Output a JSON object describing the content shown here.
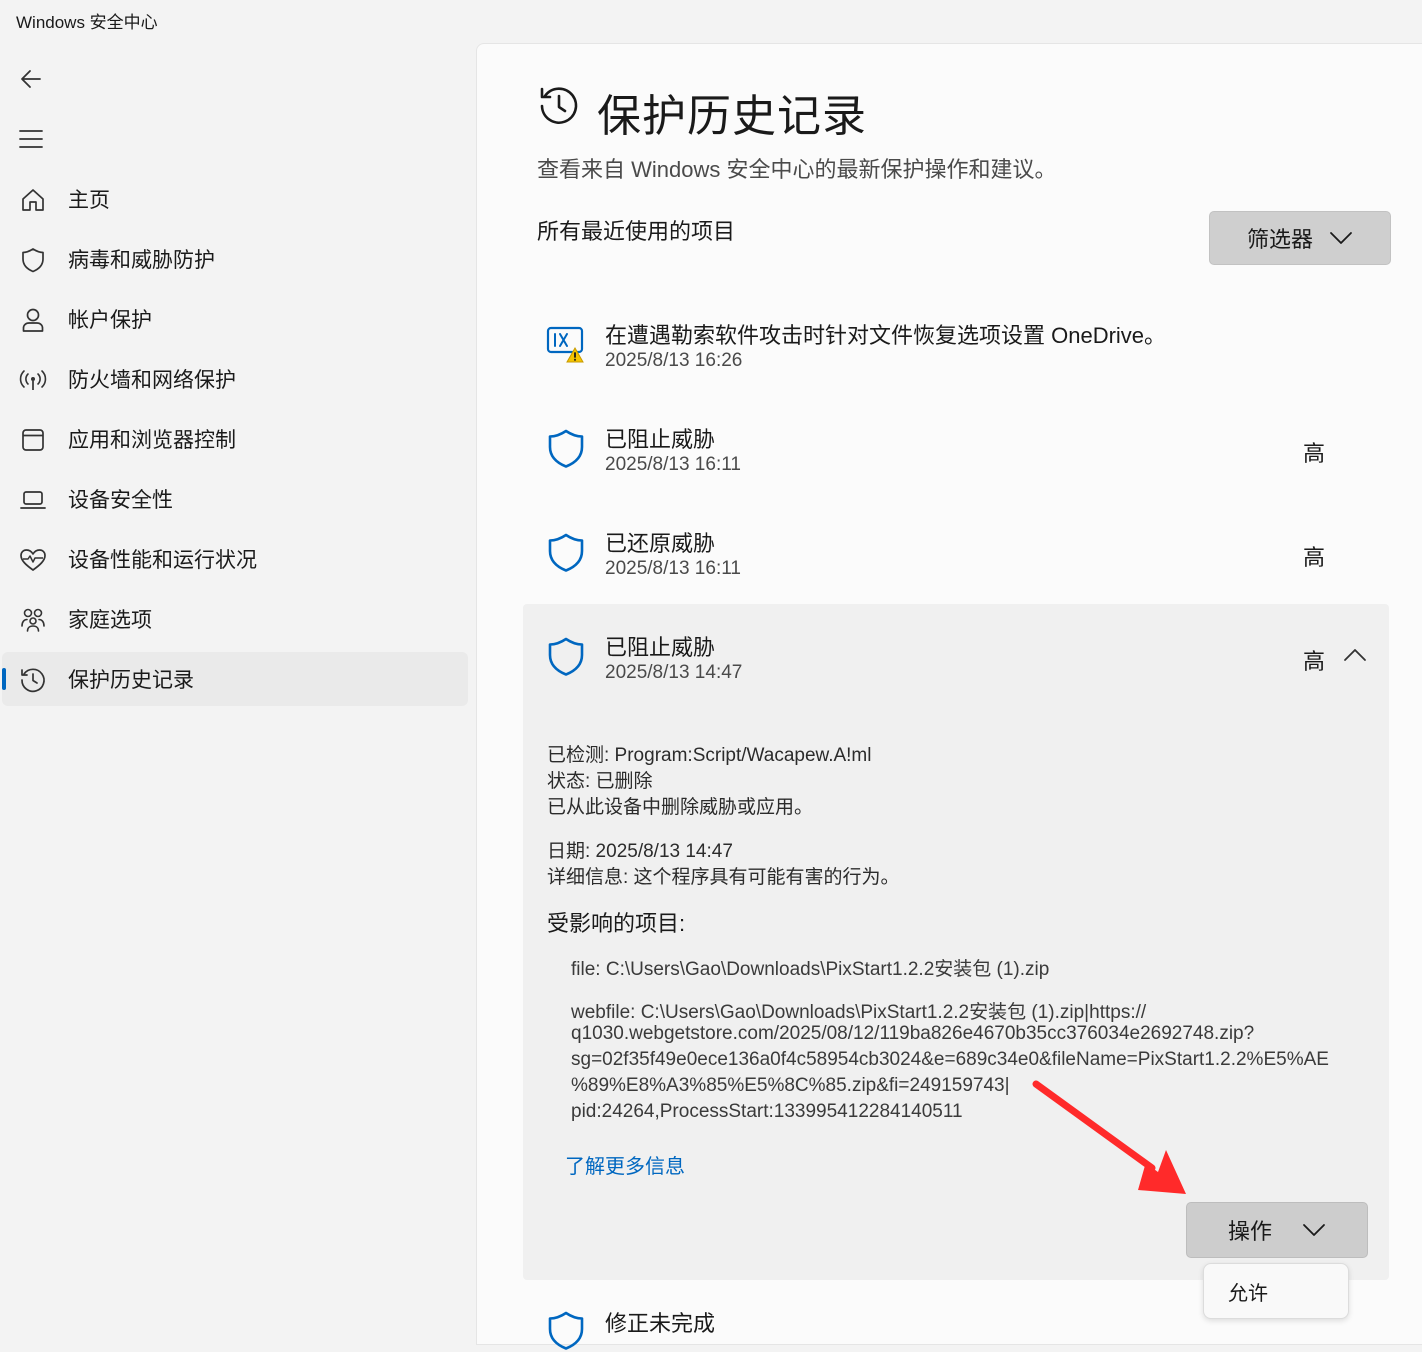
{
  "app": {
    "title": "Windows 安全中心"
  },
  "sidebar": {
    "items": [
      {
        "label": "主页",
        "icon": "home-icon"
      },
      {
        "label": "病毒和威胁防护",
        "icon": "shield-icon"
      },
      {
        "label": "帐户保护",
        "icon": "person-icon"
      },
      {
        "label": "防火墙和网络保护",
        "icon": "wifi-icon"
      },
      {
        "label": "应用和浏览器控制",
        "icon": "window-icon"
      },
      {
        "label": "设备安全性",
        "icon": "laptop-icon"
      },
      {
        "label": "设备性能和运行状况",
        "icon": "heart-icon"
      },
      {
        "label": "家庭选项",
        "icon": "family-icon"
      },
      {
        "label": "保护历史记录",
        "icon": "history-icon",
        "active": true
      }
    ]
  },
  "main": {
    "title": "保护历史记录",
    "subtitle": "查看来自 Windows 安全中心的最新保护操作和建议。",
    "section_label": "所有最近使用的项目",
    "filter_label": "筛选器",
    "entries": [
      {
        "title": "在遭遇勒索软件攻击时针对文件恢复选项设置 OneDrive。",
        "time": "2025/8/13 16:26",
        "severity": ""
      },
      {
        "title": "已阻止威胁",
        "time": "2025/8/13 16:11",
        "severity": "高"
      },
      {
        "title": "已还原威胁",
        "time": "2025/8/13 16:11",
        "severity": "高"
      },
      {
        "title": "已阻止威胁",
        "time": "2025/8/13 14:47",
        "severity": "高"
      }
    ],
    "detail": {
      "detected": "已检测:  Program:Script/Wacapew.A!ml",
      "status": "状态:  已删除",
      "status_desc": "已从此设备中删除威胁或应用。",
      "date": "日期:  2025/8/13 14:47",
      "details": "详细信息:  这个程序具有可能有害的行为。",
      "affected_title": "受影响的项目:",
      "file": "file: C:\\Users\\Gao\\Downloads\\PixStart1.2.2安装包 (1).zip",
      "webfile_lines": [
        "webfile: C:\\Users\\Gao\\Downloads\\PixStart1.2.2安装包 (1).zip|https://",
        "q1030.webgetstore.com/2025/08/12/119ba826e4670b35cc376034e2692748.zip?",
        "sg=02f35f49e0ece136a0f4c58954cb3024&e=689c34e0&fileName=PixStart1.2.2%E5%AE",
        "%89%E8%A3%85%E5%8C%85.zip&fi=249159743|",
        "pid:24264,ProcessStart:133995412284140511"
      ],
      "learn_more": "了解更多信息",
      "action_label": "操作"
    },
    "dropdown": {
      "option": "允许"
    },
    "next_entry_title": "修正未完成"
  },
  "colors": {
    "accent": "#0067c0",
    "shield": "#0067c0",
    "warning": "#f5c400",
    "arrow": "#ff2a2a"
  }
}
